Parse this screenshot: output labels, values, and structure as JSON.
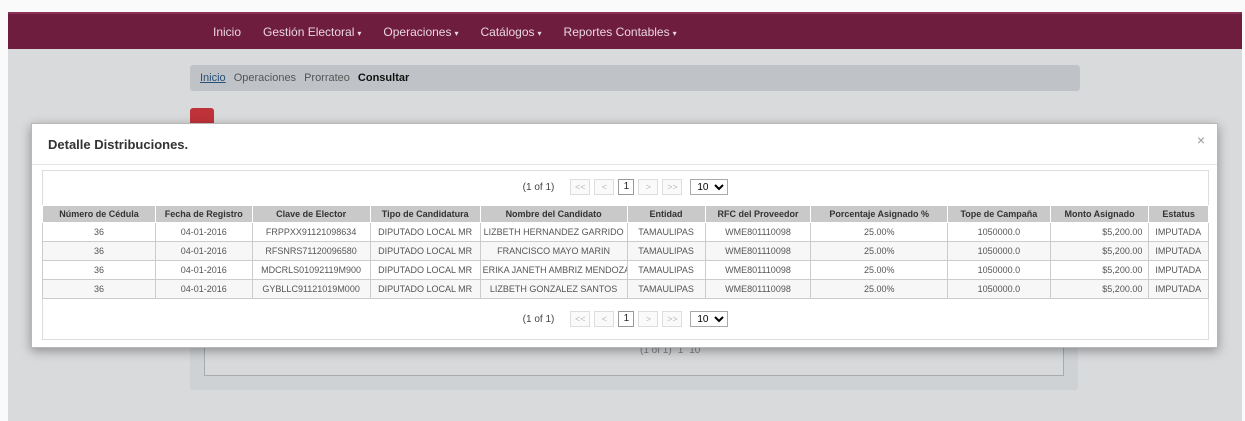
{
  "nav": {
    "items": [
      {
        "label": "Inicio",
        "dropdown": false
      },
      {
        "label": "Gestión Electoral",
        "dropdown": true
      },
      {
        "label": "Operaciones",
        "dropdown": true
      },
      {
        "label": "Catálogos",
        "dropdown": true
      },
      {
        "label": "Reportes Contables",
        "dropdown": true
      }
    ],
    "caret_icon": "caret-down-icon",
    "background_color": "#6e1d3e"
  },
  "breadcrumb": {
    "items": [
      "Inicio",
      "Operaciones",
      "Prorrateo",
      "Consultar"
    ]
  },
  "modal": {
    "title": "Detalle Distribuciones.",
    "close_label": "×",
    "pager": {
      "page_info": "(1 of 1)",
      "first": "<<",
      "prev": "<",
      "current_page": "1",
      "next": ">",
      "last": ">>",
      "rows_per_page": "10"
    },
    "table": {
      "columns": [
        "Número de Cédula",
        "Fecha de Registro",
        "Clave de Elector",
        "Tipo de Candidatura",
        "Nombre del Candidato",
        "Entidad",
        "RFC del Proveedor",
        "Porcentaje Asignado %",
        "Tope de Campaña",
        "Monto Asignado",
        "Estatus"
      ],
      "rows": [
        [
          "36",
          "04-01-2016",
          "FRPPXX91121098634",
          "DIPUTADO LOCAL MR",
          "LIZBETH HERNANDEZ GARRIDO",
          "TAMAULIPAS",
          "WME801110098",
          "25.00%",
          "1050000.0",
          "$5,200.00",
          "IMPUTADA"
        ],
        [
          "36",
          "04-01-2016",
          "RFSNRS71120096580",
          "DIPUTADO LOCAL MR",
          "FRANCISCO MAYO MARIN",
          "TAMAULIPAS",
          "WME801110098",
          "25.00%",
          "1050000.0",
          "$5,200.00",
          "IMPUTADA"
        ],
        [
          "36",
          "04-01-2016",
          "MDCRLS01092119M900",
          "DIPUTADO LOCAL MR",
          "ERIKA JANETH AMBRIZ MENDOZA",
          "TAMAULIPAS",
          "WME801110098",
          "25.00%",
          "1050000.0",
          "$5,200.00",
          "IMPUTADA"
        ],
        [
          "36",
          "04-01-2016",
          "GYBLLC91121019M000",
          "DIPUTADO LOCAL MR",
          "LIZBETH GONZALEZ SANTOS",
          "TAMAULIPAS",
          "WME801110098",
          "25.00%",
          "1050000.0",
          "$5,200.00",
          "IMPUTADA"
        ]
      ]
    }
  },
  "background_pager": {
    "page_info": "(1 of 1)",
    "current_page": "1",
    "rows_per_page": "10"
  }
}
